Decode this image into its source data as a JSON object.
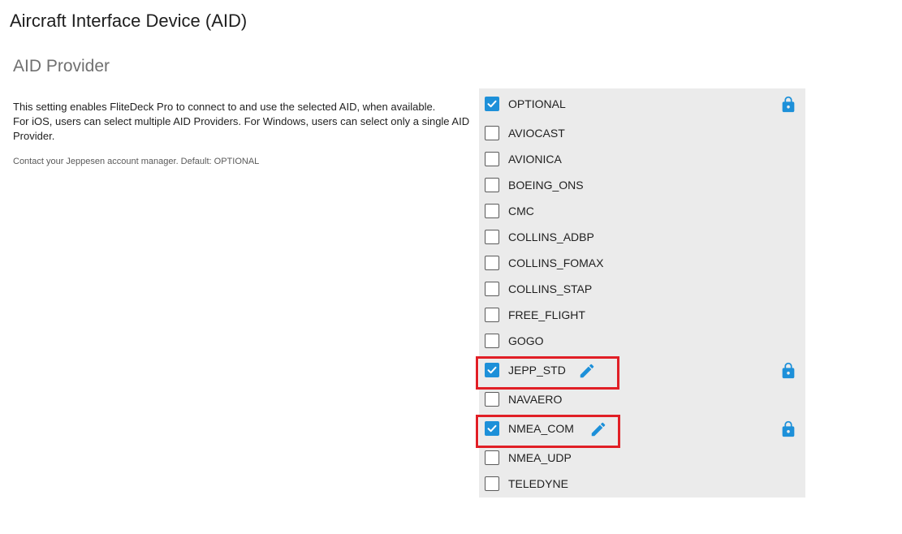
{
  "page": {
    "title": "Aircraft Interface Device (AID)",
    "section_title": "AID Provider",
    "description": [
      "This setting enables FliteDeck Pro to connect to and use the selected AID, when available.",
      "For iOS, users can select multiple AID Providers. For Windows, users can select only a single AID Provider."
    ],
    "note": "Contact your Jeppesen account manager. Default: OPTIONAL"
  },
  "colors": {
    "accent": "#1d90d9",
    "highlight": "#e11f26",
    "panel_bg": "#ebebeb"
  },
  "options": [
    {
      "label": "OPTIONAL",
      "checked": true,
      "locked": true,
      "editable": false,
      "highlighted": false
    },
    {
      "label": "AVIOCAST",
      "checked": false,
      "locked": false,
      "editable": false,
      "highlighted": false
    },
    {
      "label": "AVIONICA",
      "checked": false,
      "locked": false,
      "editable": false,
      "highlighted": false
    },
    {
      "label": "BOEING_ONS",
      "checked": false,
      "locked": false,
      "editable": false,
      "highlighted": false
    },
    {
      "label": "CMC",
      "checked": false,
      "locked": false,
      "editable": false,
      "highlighted": false
    },
    {
      "label": "COLLINS_ADBP",
      "checked": false,
      "locked": false,
      "editable": false,
      "highlighted": false
    },
    {
      "label": "COLLINS_FOMAX",
      "checked": false,
      "locked": false,
      "editable": false,
      "highlighted": false
    },
    {
      "label": "COLLINS_STAP",
      "checked": false,
      "locked": false,
      "editable": false,
      "highlighted": false
    },
    {
      "label": "FREE_FLIGHT",
      "checked": false,
      "locked": false,
      "editable": false,
      "highlighted": false
    },
    {
      "label": "GOGO",
      "checked": false,
      "locked": false,
      "editable": false,
      "highlighted": false
    },
    {
      "label": "JEPP_STD",
      "checked": true,
      "locked": true,
      "editable": true,
      "highlighted": true
    },
    {
      "label": "NAVAERO",
      "checked": false,
      "locked": false,
      "editable": false,
      "highlighted": false
    },
    {
      "label": "NMEA_COM",
      "checked": true,
      "locked": true,
      "editable": true,
      "highlighted": true
    },
    {
      "label": "NMEA_UDP",
      "checked": false,
      "locked": false,
      "editable": false,
      "highlighted": false
    },
    {
      "label": "TELEDYNE",
      "checked": false,
      "locked": false,
      "editable": false,
      "highlighted": false
    }
  ]
}
